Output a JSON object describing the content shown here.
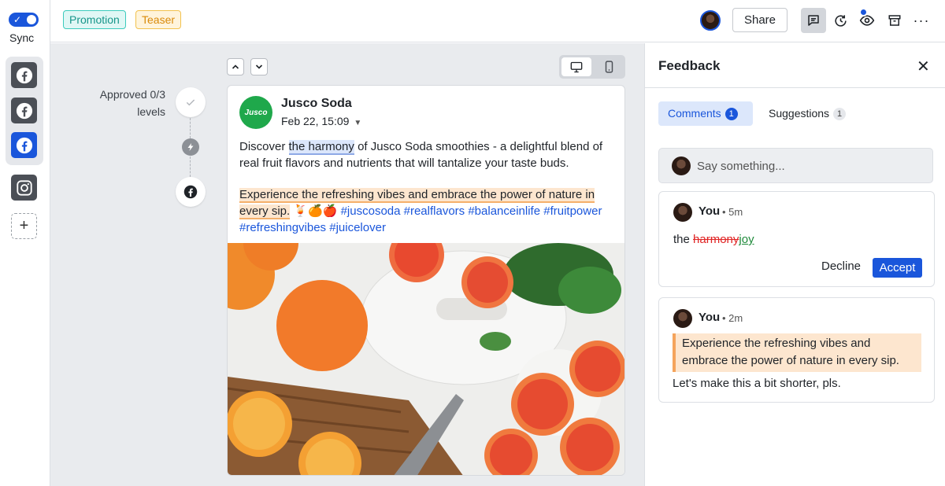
{
  "sidebar": {
    "sync_label": "Sync",
    "channels": [
      {
        "icon": "facebook-icon",
        "state": "inactive"
      },
      {
        "icon": "facebook-icon",
        "state": "inactive"
      },
      {
        "icon": "facebook-icon",
        "state": "active"
      },
      {
        "icon": "instagram-icon",
        "state": "inactive"
      }
    ],
    "add_label": "+"
  },
  "topbar": {
    "tags": [
      {
        "label": "Promotion",
        "color": "#16958a"
      },
      {
        "label": "Teaser",
        "color": "#d98a0a"
      }
    ],
    "share_label": "Share",
    "more_label": "···"
  },
  "approval": {
    "label": "Approved 0/3 levels"
  },
  "post": {
    "brand_logo_text": "Jusco",
    "brand_name": "Jusco Soda",
    "date": "Feb 22, 15:09",
    "text_part1": "Discover ",
    "text_highlight": "the harmony",
    "text_part2": " of Jusco Soda smoothies - a delightful blend of real fruit flavors and nutrients that will tantalize your taste buds.",
    "text_highlight2": "Experience the refreshing vibes and embrace the power of nature in every sip.",
    "emoji": " 🍹🍊🍎 ",
    "hashtags": "#juscosoda #realflavors #balanceinlife #fruitpower #refreshingvibes #juicelover"
  },
  "feedback": {
    "title": "Feedback",
    "tabs": [
      {
        "label": "Comments",
        "count": "1"
      },
      {
        "label": "Suggestions",
        "count": "1"
      }
    ],
    "input_placeholder": "Say something...",
    "suggestion": {
      "author": "You",
      "time": "• 5m",
      "prefix": "the ",
      "deleted": "harmony",
      "inserted": "joy",
      "decline_label": "Decline",
      "accept_label": "Accept"
    },
    "comment": {
      "author": "You",
      "time": "• 2m",
      "quote": "Experience the refreshing vibes and embrace the power of nature in every sip.",
      "text": "Let's make this a bit shorter, pls."
    }
  },
  "colors": {
    "accent": "#1a56db",
    "brand_green": "#1fa84b",
    "highlight_orange": "#fde6cf"
  }
}
